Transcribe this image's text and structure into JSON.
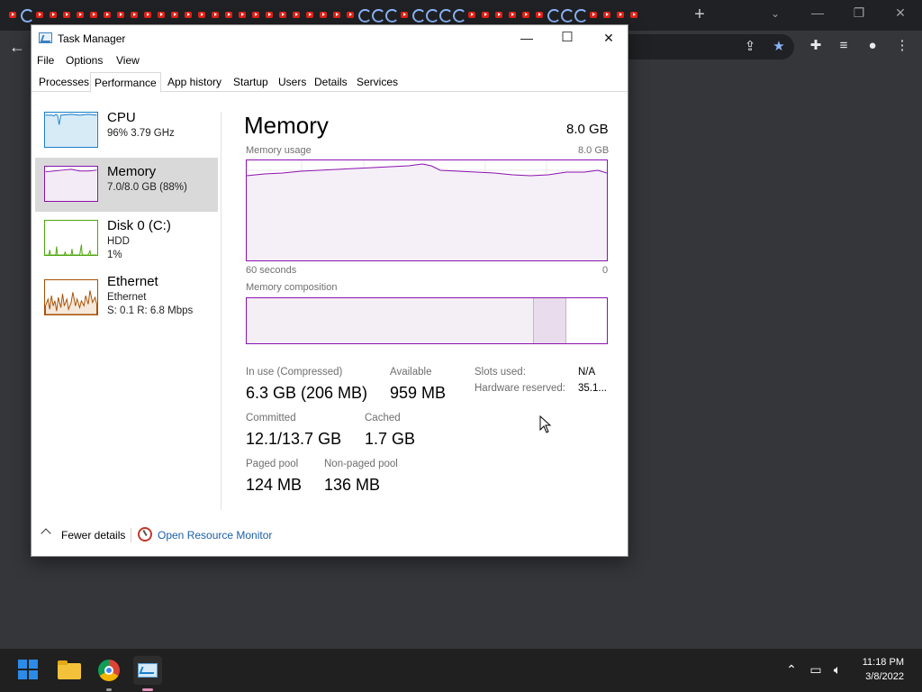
{
  "browser": {
    "tab_icons": [
      "yt",
      "load",
      "yt",
      "yt",
      "yt",
      "yt",
      "yt",
      "yt",
      "yt",
      "yt",
      "yt",
      "yt",
      "yt",
      "yt",
      "yt",
      "yt",
      "yt",
      "yt",
      "yt",
      "yt",
      "yt",
      "yt",
      "yt",
      "yt",
      "yt",
      "yt",
      "load",
      "load",
      "load",
      "yt",
      "load",
      "load",
      "load",
      "load",
      "yt",
      "yt",
      "yt",
      "yt",
      "yt",
      "yt",
      "load",
      "load",
      "load",
      "yt",
      "yt",
      "yt",
      "yt"
    ],
    "new_tab": "+",
    "back": "←"
  },
  "window": {
    "title": "Task Manager",
    "minimize": "—",
    "maximize": "☐",
    "close": "✕"
  },
  "menu": [
    "File",
    "Options",
    "View"
  ],
  "tabs": [
    "Processes",
    "Performance",
    "App history",
    "Startup",
    "Users",
    "Details",
    "Services"
  ],
  "sidebar": {
    "items": [
      {
        "name": "CPU",
        "line1": "96%  3.79 GHz",
        "line2": ""
      },
      {
        "name": "Memory",
        "line1": "7.0/8.0 GB (88%)",
        "line2": ""
      },
      {
        "name": "Disk 0 (C:)",
        "line1": "HDD",
        "line2": "1%"
      },
      {
        "name": "Ethernet",
        "line1": "Ethernet",
        "line2": "S: 0.1  R: 6.8 Mbps"
      }
    ]
  },
  "memory": {
    "title": "Memory",
    "total": "8.0 GB",
    "usage_label": "Memory usage",
    "usage_max": "8.0 GB",
    "time_left": "60 seconds",
    "time_right": "0",
    "composition_label": "Memory composition",
    "stats": {
      "in_use_label": "In use (Compressed)",
      "in_use_value": "6.3 GB (206 MB)",
      "available_label": "Available",
      "available_value": "959 MB",
      "committed_label": "Committed",
      "committed_value": "12.1/13.7 GB",
      "cached_label": "Cached",
      "cached_value": "1.7 GB",
      "paged_label": "Paged pool",
      "paged_value": "124 MB",
      "nonpaged_label": "Non-paged pool",
      "nonpaged_value": "136 MB",
      "slots_label": "Slots used:",
      "slots_value": "N/A",
      "hwres_label": "Hardware reserved:",
      "hwres_value": "35.1..."
    }
  },
  "footer": {
    "fewer_details": "Fewer details",
    "open_resmon": "Open Resource Monitor"
  },
  "taskbar": {
    "time": "11:18 PM",
    "date": "3/8/2022"
  },
  "colors": {
    "memory_accent": "#8b12ae",
    "cpu_accent": "#1a7ec9",
    "disk_accent": "#4da60c",
    "ethernet_accent": "#a74f01"
  }
}
